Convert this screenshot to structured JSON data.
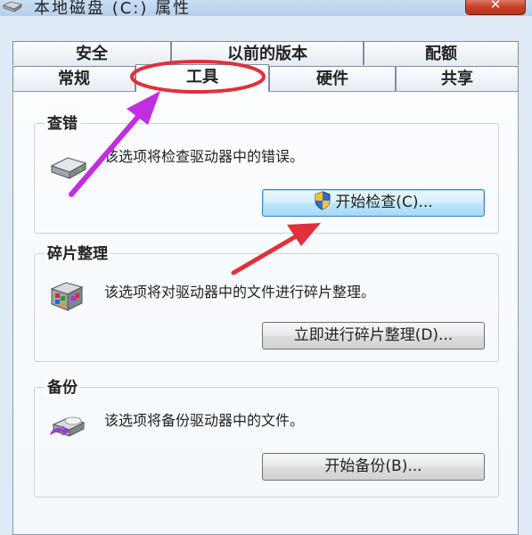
{
  "window": {
    "title": "本地磁盘 (C:) 属性",
    "close_glyph": "✕"
  },
  "tabs": {
    "top_row": [
      "安全",
      "以前的版本",
      "配额"
    ],
    "bottom_row": [
      "常规",
      "工具",
      "硬件",
      "共享"
    ],
    "active": "工具"
  },
  "groups": {
    "check": {
      "title": "查错",
      "description": "该选项将检查驱动器中的错误。",
      "button": "开始检查(C)...",
      "icon": "hard-drive-icon"
    },
    "defrag": {
      "title": "碎片整理",
      "description": "该选项将对驱动器中的文件进行碎片整理。",
      "button": "立即进行碎片整理(D)...",
      "icon": "defrag-icon"
    },
    "backup": {
      "title": "备份",
      "description": "该选项将备份驱动器中的文件。",
      "button": "开始备份(B)...",
      "icon": "backup-icon"
    }
  },
  "annotations": {
    "highlight_color": "#e0303a",
    "arrow_purple": "#c02ee0",
    "arrow_red": "#e0303a"
  }
}
